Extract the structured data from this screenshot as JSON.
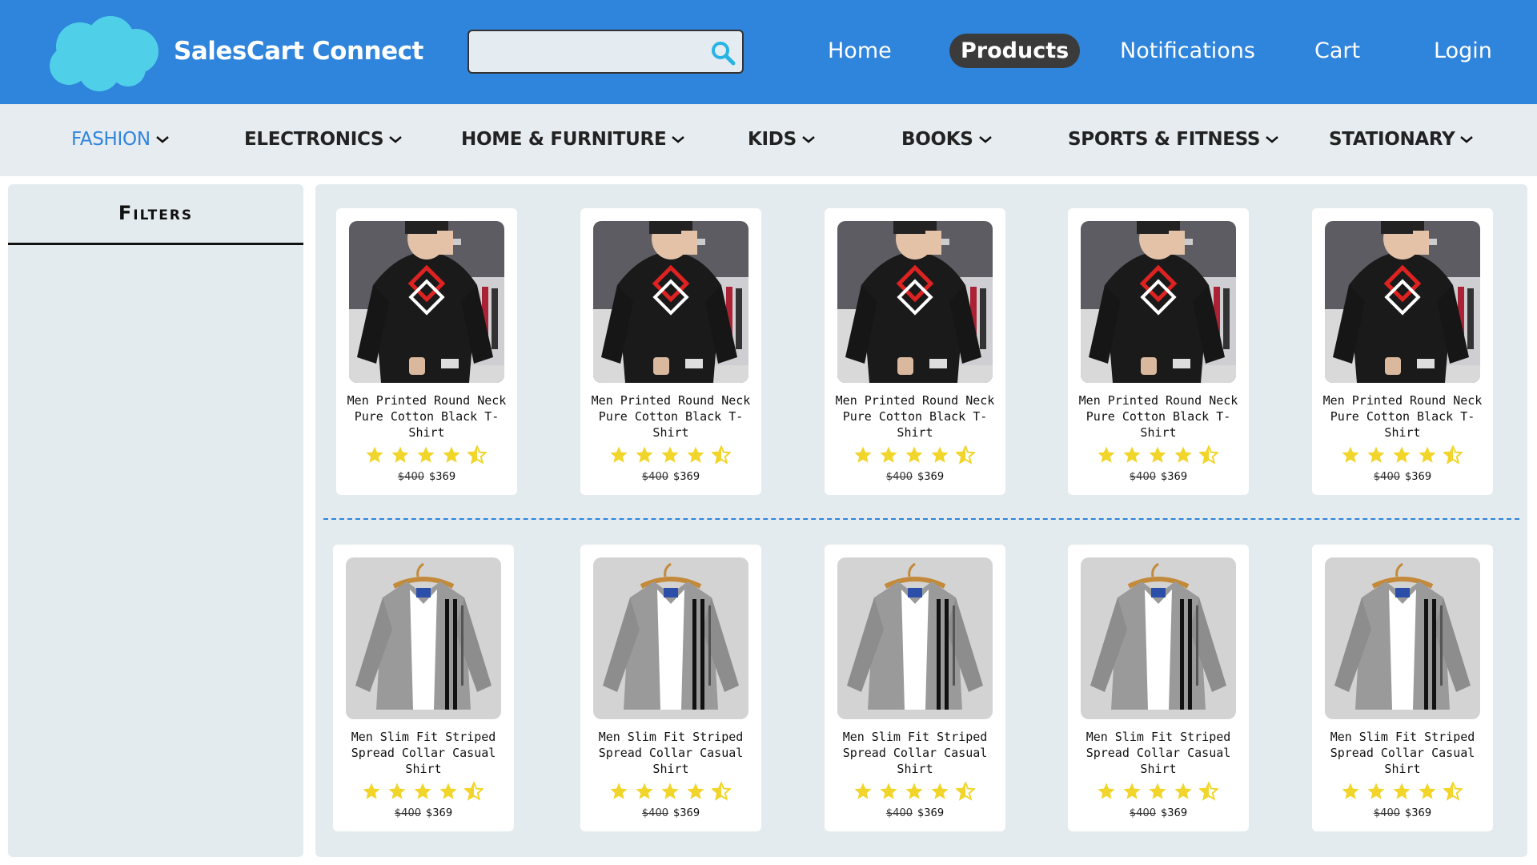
{
  "header": {
    "brand": "SalesCart Connect",
    "search": {
      "value": "",
      "placeholder": ""
    },
    "nav": [
      {
        "label": "Home"
      },
      {
        "label": "Products",
        "active": true
      },
      {
        "label": "Notifications"
      },
      {
        "label": "Cart"
      },
      {
        "label": "Login"
      }
    ]
  },
  "categories": [
    {
      "label": "FASHION",
      "active": true
    },
    {
      "label": "ELECTRONICS"
    },
    {
      "label": "HOME & FURNITURE"
    },
    {
      "label": "KIDS"
    },
    {
      "label": "BOOKS"
    },
    {
      "label": "SPORTS & FITNESS"
    },
    {
      "label": "STATIONARY"
    }
  ],
  "filters": {
    "title": "Filters"
  },
  "products": {
    "row1": [
      {
        "title": "Men Printed Round Neck Pure Cotton Black T-Shirt",
        "rating": 4.5,
        "old_price": "$400",
        "price": "$369",
        "image": "black-tshirt"
      },
      {
        "title": "Men Printed Round Neck Pure Cotton Black T-Shirt",
        "rating": 4.5,
        "old_price": "$400",
        "price": "$369",
        "image": "black-tshirt"
      },
      {
        "title": "Men Printed Round Neck Pure Cotton Black T-Shirt",
        "rating": 4.5,
        "old_price": "$400",
        "price": "$369",
        "image": "black-tshirt"
      },
      {
        "title": "Men Printed Round Neck Pure Cotton Black T-Shirt",
        "rating": 4.5,
        "old_price": "$400",
        "price": "$369",
        "image": "black-tshirt"
      },
      {
        "title": "Men Printed Round Neck Pure Cotton Black T-Shirt",
        "rating": 4.5,
        "old_price": "$400",
        "price": "$369",
        "image": "black-tshirt"
      }
    ],
    "row2": [
      {
        "title": "Men Slim Fit Striped Spread Collar Casual Shirt",
        "rating": 4.5,
        "old_price": "$400",
        "price": "$369",
        "image": "grey-shirt"
      },
      {
        "title": "Men Slim Fit Striped Spread Collar Casual Shirt",
        "rating": 4.5,
        "old_price": "$400",
        "price": "$369",
        "image": "grey-shirt"
      },
      {
        "title": "Men Slim Fit Striped Spread Collar Casual Shirt",
        "rating": 4.5,
        "old_price": "$400",
        "price": "$369",
        "image": "grey-shirt"
      },
      {
        "title": "Men Slim Fit Striped Spread Collar Casual Shirt",
        "rating": 4.5,
        "old_price": "$400",
        "price": "$369",
        "image": "grey-shirt"
      },
      {
        "title": "Men Slim Fit Striped Spread Collar Casual Shirt",
        "rating": 4.5,
        "old_price": "$400",
        "price": "$369",
        "image": "grey-shirt"
      }
    ]
  },
  "colors": {
    "brand_blue": "#2f84dc",
    "star": "#f2d52a",
    "panel": "#e4ebef"
  },
  "icons": {
    "logo": "cloud-logo-icon",
    "search": "search-icon",
    "chevron": "chevron-down-icon",
    "star": "star-icon"
  }
}
